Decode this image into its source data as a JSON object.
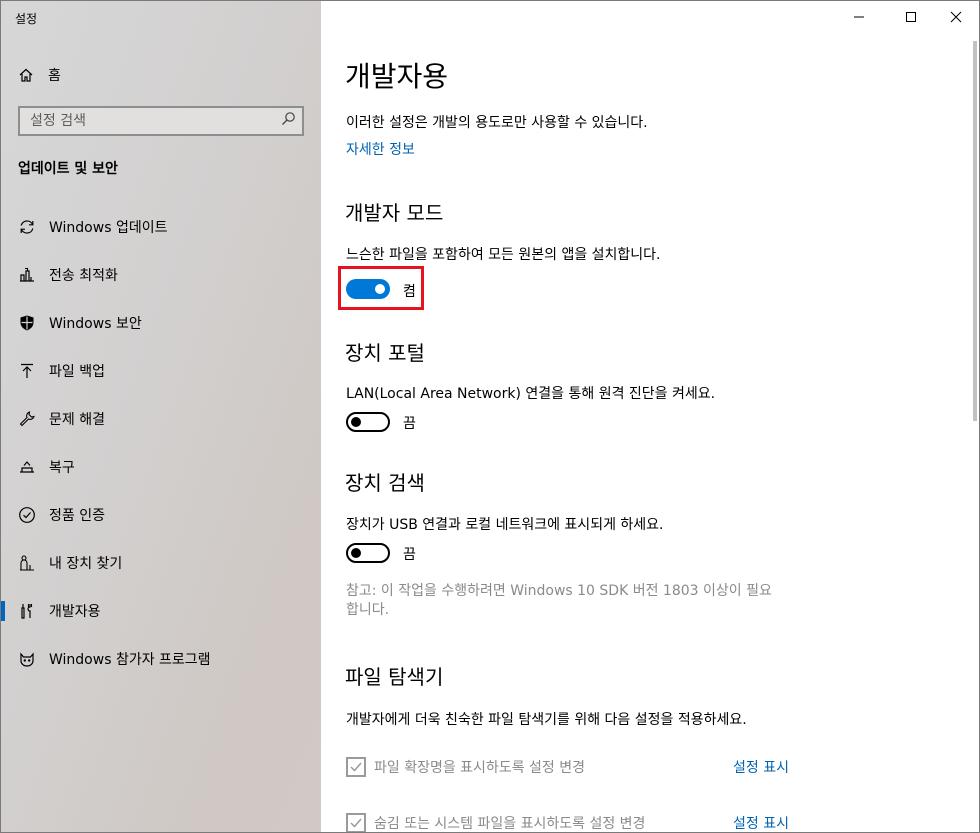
{
  "window": {
    "title": "설정"
  },
  "sidebar": {
    "home_label": "홈",
    "search_placeholder": "설정 검색",
    "section_title": "업데이트 및 보안",
    "items": [
      {
        "label": "Windows 업데이트",
        "icon": "refresh-icon"
      },
      {
        "label": "전송 최적화",
        "icon": "delivery-optimization-icon"
      },
      {
        "label": "Windows 보안",
        "icon": "shield-icon"
      },
      {
        "label": "파일 백업",
        "icon": "upload-arrow-icon"
      },
      {
        "label": "문제 해결",
        "icon": "wrench-icon"
      },
      {
        "label": "복구",
        "icon": "recovery-icon"
      },
      {
        "label": "정품 인증",
        "icon": "check-circle-icon"
      },
      {
        "label": "내 장치 찾기",
        "icon": "person-pin-icon"
      },
      {
        "label": "개발자용",
        "icon": "developer-tools-icon",
        "active": true
      },
      {
        "label": "Windows 참가자 프로그램",
        "icon": "insider-cat-icon"
      }
    ]
  },
  "main": {
    "title": "개발자용",
    "description": "이러한 설정은 개발의 용도로만 사용할 수 있습니다.",
    "more_info_link": "자세한 정보",
    "developer_mode": {
      "heading": "개발자 모드",
      "description": "느슨한 파일을 포함하여 모든 원본의 앱을 설치합니다.",
      "state_label": "켬",
      "on": true
    },
    "device_portal": {
      "heading": "장치 포털",
      "description": "LAN(Local Area Network) 연결을 통해 원격 진단을 켜세요.",
      "state_label": "끔",
      "on": false
    },
    "device_discovery": {
      "heading": "장치 검색",
      "description": "장치가 USB 연결과 로컬 네트워크에 표시되게 하세요.",
      "state_label": "끔",
      "on": false,
      "note_line1": "참고: 이 작업을 수행하려면 Windows 10 SDK 버전 1803 이상이 필요",
      "note_line2": "합니다."
    },
    "file_explorer": {
      "heading": "파일 탐색기",
      "description": "개발자에게 더욱 친숙한 파일 탐색기를 위해 다음 설정을 적용하세요.",
      "options": [
        {
          "label": "파일 확장명을 표시하도록 설정 변경",
          "link": "설정 표시",
          "checked": true
        },
        {
          "label": "숨김 또는 시스템 파일을 표시하도록 설정 변경",
          "link": "설정 표시",
          "checked": true
        }
      ]
    }
  },
  "colors": {
    "accent": "#0078d7",
    "link": "#0063b1",
    "highlight": "#e3141f"
  }
}
